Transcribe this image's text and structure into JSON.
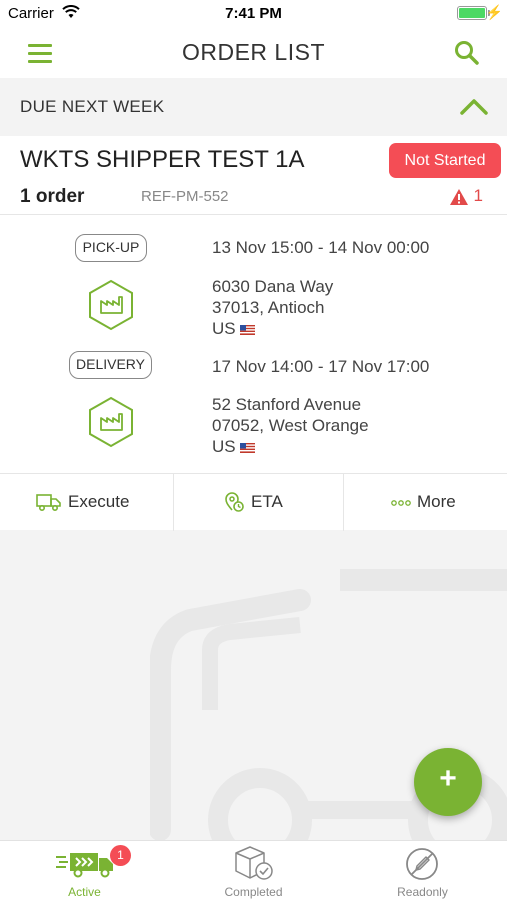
{
  "status_bar": {
    "carrier": "Carrier",
    "time": "7:41 PM"
  },
  "nav": {
    "title": "ORDER LIST"
  },
  "section": {
    "label": "DUE NEXT WEEK"
  },
  "card": {
    "shipper": "WKTS SHIPPER TEST 1A",
    "status": "Not Started",
    "order_count": "1 order",
    "reference": "REF-PM-552",
    "alert_count": "1",
    "stops": [
      {
        "type": "PICK-UP",
        "time": "13 Nov 15:00 - 14 Nov 00:00",
        "street": "6030 Dana Way",
        "city": "37013, Antioch",
        "country": "US"
      },
      {
        "type": "DELIVERY",
        "time": "17 Nov 14:00 - 17 Nov 17:00",
        "street": "52 Stanford Avenue",
        "city": "07052, West Orange",
        "country": "US"
      }
    ]
  },
  "actions": {
    "execute": "Execute",
    "eta": "ETA",
    "more": "More"
  },
  "fab": {
    "label": "+"
  },
  "tabs": [
    {
      "label": "Active",
      "badge": "1"
    },
    {
      "label": "Completed"
    },
    {
      "label": "Readonly"
    }
  ],
  "colors": {
    "accent": "#7ab333",
    "status_red": "#f44d55",
    "alert_red": "#e24a4a"
  }
}
